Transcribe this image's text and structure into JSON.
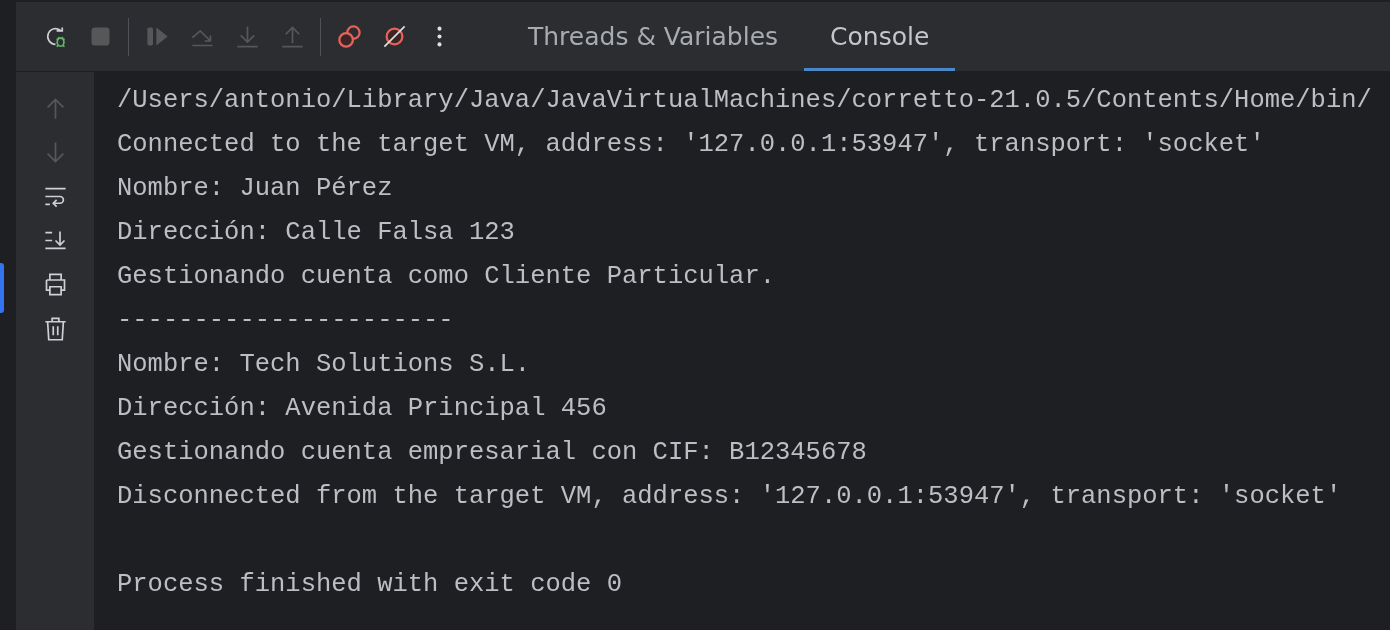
{
  "toolbar": {
    "buttons": [
      {
        "kind": "rerun-debug",
        "disabled": false
      },
      {
        "kind": "stop",
        "disabled": true
      },
      {
        "kind": "separator"
      },
      {
        "kind": "resume",
        "disabled": true
      },
      {
        "kind": "step-over",
        "disabled": true
      },
      {
        "kind": "step-into",
        "disabled": true
      },
      {
        "kind": "step-out",
        "disabled": true
      },
      {
        "kind": "separator"
      },
      {
        "kind": "view-breakpoints",
        "disabled": false
      },
      {
        "kind": "mute-breakpoints",
        "disabled": false
      },
      {
        "kind": "more",
        "disabled": false
      }
    ]
  },
  "tabs": [
    {
      "label": "Threads & Variables",
      "selected": false
    },
    {
      "label": "Console",
      "selected": true
    }
  ],
  "side_toolbar": [
    {
      "kind": "up",
      "disabled": true
    },
    {
      "kind": "down",
      "disabled": true
    },
    {
      "kind": "wrap",
      "disabled": false
    },
    {
      "kind": "scroll-end",
      "disabled": false
    },
    {
      "kind": "print",
      "disabled": false
    },
    {
      "kind": "clear",
      "disabled": false
    }
  ],
  "console": {
    "lines": [
      "/Users/antonio/Library/Java/JavaVirtualMachines/corretto-21.0.5/Contents/Home/bin/",
      "Connected to the target VM, address: '127.0.0.1:53947', transport: 'socket'",
      "Nombre: Juan Pérez",
      "Dirección: Calle Falsa 123",
      "Gestionando cuenta como Cliente Particular.",
      "----------------------",
      "Nombre: Tech Solutions S.L.",
      "Dirección: Avenida Principal 456",
      "Gestionando cuenta empresarial con CIF: B12345678",
      "Disconnected from the target VM, address: '127.0.0.1:53947', transport: 'socket'"
    ],
    "exit_message": "Process finished with exit code 0"
  }
}
